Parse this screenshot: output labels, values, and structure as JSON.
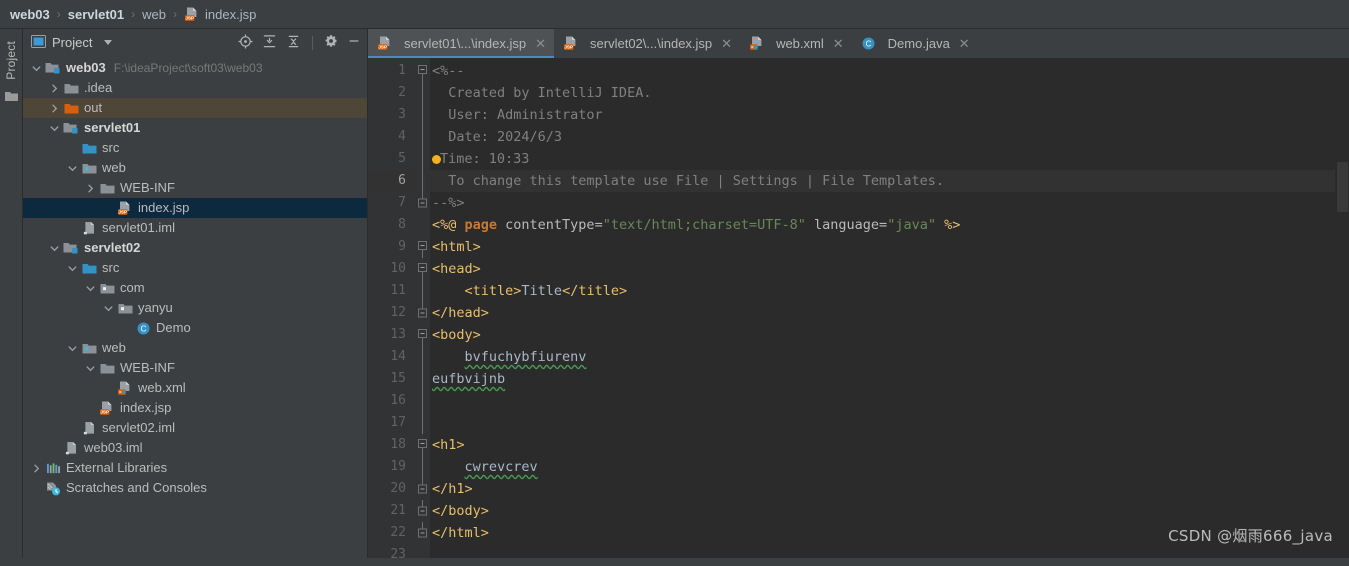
{
  "breadcrumb": {
    "items": [
      {
        "label": "web03",
        "bold": true,
        "icon": null
      },
      {
        "label": "servlet01",
        "bold": true,
        "icon": null
      },
      {
        "label": "web",
        "bold": false,
        "icon": null
      },
      {
        "label": "index.jsp",
        "bold": false,
        "icon": "jsp-file-icon"
      }
    ],
    "separator": "›"
  },
  "toolstrip": {
    "project_label": "Project",
    "folder_icon": "folder-icon"
  },
  "project_panel": {
    "title": "Project",
    "title_icon": "project-view-icon",
    "dropdown_icon": "chevron-down-icon",
    "actions": [
      {
        "name": "select-opened-file-icon",
        "tooltip": "Select Opened File"
      },
      {
        "name": "expand-all-icon",
        "tooltip": "Expand All"
      },
      {
        "name": "collapse-all-icon",
        "tooltip": "Collapse All"
      },
      {
        "name": "gear-icon",
        "tooltip": "Settings"
      },
      {
        "name": "hide-icon",
        "tooltip": "Hide"
      }
    ],
    "tree": [
      {
        "indent": 0,
        "twisty": "down",
        "icon": "module-folder-icon",
        "label": "web03",
        "bold": true,
        "path": "F:\\ideaProject\\soft03\\web03",
        "state": "normal"
      },
      {
        "indent": 1,
        "twisty": "right",
        "icon": "folder-icon",
        "label": ".idea",
        "bold": false,
        "path": "",
        "state": "normal"
      },
      {
        "indent": 1,
        "twisty": "right",
        "icon": "folder-orange-icon",
        "label": "out",
        "bold": false,
        "path": "",
        "state": "highlight"
      },
      {
        "indent": 1,
        "twisty": "down",
        "icon": "module-folder-icon",
        "label": "servlet01",
        "bold": true,
        "path": "",
        "state": "normal"
      },
      {
        "indent": 2,
        "twisty": "none",
        "icon": "source-folder-icon",
        "label": "src",
        "bold": false,
        "path": "",
        "state": "normal"
      },
      {
        "indent": 2,
        "twisty": "down",
        "icon": "web-folder-icon",
        "label": "web",
        "bold": false,
        "path": "",
        "state": "normal"
      },
      {
        "indent": 3,
        "twisty": "right",
        "icon": "folder-icon",
        "label": "WEB-INF",
        "bold": false,
        "path": "",
        "state": "normal"
      },
      {
        "indent": 4,
        "twisty": "none",
        "icon": "jsp-file-icon",
        "label": "index.jsp",
        "bold": false,
        "path": "",
        "state": "selected"
      },
      {
        "indent": 2,
        "twisty": "none",
        "icon": "iml-file-icon",
        "label": "servlet01.iml",
        "bold": false,
        "path": "",
        "state": "normal"
      },
      {
        "indent": 1,
        "twisty": "down",
        "icon": "module-folder-icon",
        "label": "servlet02",
        "bold": true,
        "path": "",
        "state": "normal"
      },
      {
        "indent": 2,
        "twisty": "down",
        "icon": "source-folder-icon",
        "label": "src",
        "bold": false,
        "path": "",
        "state": "normal"
      },
      {
        "indent": 3,
        "twisty": "down",
        "icon": "package-folder-icon",
        "label": "com",
        "bold": false,
        "path": "",
        "state": "normal"
      },
      {
        "indent": 4,
        "twisty": "down",
        "icon": "package-folder-icon",
        "label": "yanyu",
        "bold": false,
        "path": "",
        "state": "normal"
      },
      {
        "indent": 5,
        "twisty": "none",
        "icon": "java-class-icon",
        "label": "Demo",
        "bold": false,
        "path": "",
        "state": "normal"
      },
      {
        "indent": 2,
        "twisty": "down",
        "icon": "web-folder-icon",
        "label": "web",
        "bold": false,
        "path": "",
        "state": "normal"
      },
      {
        "indent": 3,
        "twisty": "down",
        "icon": "folder-icon",
        "label": "WEB-INF",
        "bold": false,
        "path": "",
        "state": "normal"
      },
      {
        "indent": 4,
        "twisty": "none",
        "icon": "xml-file-icon",
        "label": "web.xml",
        "bold": false,
        "path": "",
        "state": "normal"
      },
      {
        "indent": 3,
        "twisty": "none",
        "icon": "jsp-file-icon",
        "label": "index.jsp",
        "bold": false,
        "path": "",
        "state": "normal"
      },
      {
        "indent": 2,
        "twisty": "none",
        "icon": "iml-file-icon",
        "label": "servlet02.iml",
        "bold": false,
        "path": "",
        "state": "normal"
      },
      {
        "indent": 1,
        "twisty": "none",
        "icon": "iml-file-icon",
        "label": "web03.iml",
        "bold": false,
        "path": "",
        "state": "normal"
      },
      {
        "indent": 0,
        "twisty": "right",
        "icon": "external-libraries-icon",
        "label": "External Libraries",
        "bold": false,
        "path": "",
        "state": "normal"
      },
      {
        "indent": 0,
        "twisty": "none",
        "icon": "scratches-icon",
        "label": "Scratches and Consoles",
        "bold": false,
        "path": "",
        "state": "normal"
      }
    ]
  },
  "editor": {
    "tabs": [
      {
        "label": "servlet01\\...\\index.jsp",
        "icon": "jsp-file-icon",
        "active": true,
        "close": "✕"
      },
      {
        "label": "servlet02\\...\\index.jsp",
        "icon": "jsp-file-icon",
        "active": false,
        "close": "✕"
      },
      {
        "label": "web.xml",
        "icon": "xml-file-icon",
        "active": false,
        "close": "✕"
      },
      {
        "label": "Demo.java",
        "icon": "java-class-icon",
        "active": false,
        "close": "✕"
      }
    ],
    "current_line": 6,
    "line_numbers": [
      "1",
      "2",
      "3",
      "4",
      "5",
      "6",
      "7",
      "8",
      "9",
      "10",
      "11",
      "12",
      "13",
      "14",
      "15",
      "16",
      "17",
      "18",
      "19",
      "20",
      "21",
      "22",
      "23"
    ],
    "lines": [
      {
        "n": 1,
        "fold": "start",
        "tokens": [
          {
            "t": "<%--",
            "c": "tok-cmt"
          }
        ]
      },
      {
        "n": 2,
        "fold": "bar",
        "tokens": [
          {
            "t": "  Created by IntelliJ IDEA.",
            "c": "tok-cmt"
          }
        ]
      },
      {
        "n": 3,
        "fold": "bar",
        "tokens": [
          {
            "t": "  User: Administrator",
            "c": "tok-cmt"
          }
        ]
      },
      {
        "n": 4,
        "fold": "bar",
        "tokens": [
          {
            "t": "  Date: 2024/6/3",
            "c": "tok-cmt"
          }
        ]
      },
      {
        "n": 5,
        "fold": "bar",
        "bulb": true,
        "tokens": [
          {
            "t": "Time: 10:33",
            "c": "tok-cmt"
          }
        ]
      },
      {
        "n": 6,
        "fold": "bar",
        "tokens": [
          {
            "t": "  To change this template use File | Settings | File Templates.",
            "c": "tok-cmt"
          }
        ]
      },
      {
        "n": 7,
        "fold": "end",
        "tokens": [
          {
            "t": "--%>",
            "c": "tok-cmt"
          }
        ]
      },
      {
        "n": 8,
        "fold": "none",
        "tokens": [
          {
            "t": "<%@ ",
            "c": "tok-dir"
          },
          {
            "t": "page",
            "c": "tok-kw"
          },
          {
            "t": " contentType=",
            "c": "tok-attr"
          },
          {
            "t": "\"text/html;charset=UTF-8\"",
            "c": "tok-str"
          },
          {
            "t": " language=",
            "c": "tok-attr"
          },
          {
            "t": "\"java\"",
            "c": "tok-str"
          },
          {
            "t": " %>",
            "c": "tok-dir"
          }
        ]
      },
      {
        "n": 9,
        "fold": "start",
        "tokens": [
          {
            "t": "<html>",
            "c": "tok-tag"
          }
        ]
      },
      {
        "n": 10,
        "fold": "start",
        "tokens": [
          {
            "t": "<head>",
            "c": "tok-tag"
          }
        ]
      },
      {
        "n": 11,
        "fold": "bar",
        "tokens": [
          {
            "t": "    ",
            "c": "tok-plain"
          },
          {
            "t": "<title>",
            "c": "tok-tag"
          },
          {
            "t": "Title",
            "c": "tok-txt"
          },
          {
            "t": "</title>",
            "c": "tok-tag"
          }
        ]
      },
      {
        "n": 12,
        "fold": "end",
        "tokens": [
          {
            "t": "</head>",
            "c": "tok-tag"
          }
        ]
      },
      {
        "n": 13,
        "fold": "start",
        "tokens": [
          {
            "t": "<body>",
            "c": "tok-tag"
          }
        ]
      },
      {
        "n": 14,
        "fold": "bar",
        "tokens": [
          {
            "t": "    ",
            "c": "tok-plain"
          },
          {
            "t": "bvfuchybfiurenv",
            "c": "tok-txt spell"
          }
        ]
      },
      {
        "n": 15,
        "fold": "bar",
        "tokens": [
          {
            "t": "eufbvijnb",
            "c": "tok-txt spell"
          }
        ]
      },
      {
        "n": 16,
        "fold": "bar",
        "tokens": [
          {
            "t": "",
            "c": "tok-plain"
          }
        ]
      },
      {
        "n": 17,
        "fold": "bar",
        "tokens": [
          {
            "t": "",
            "c": "tok-plain"
          }
        ]
      },
      {
        "n": 18,
        "fold": "start",
        "tokens": [
          {
            "t": "<h1>",
            "c": "tok-tag"
          }
        ]
      },
      {
        "n": 19,
        "fold": "bar",
        "tokens": [
          {
            "t": "    ",
            "c": "tok-plain"
          },
          {
            "t": "cwrevcrev",
            "c": "tok-txt spell"
          }
        ]
      },
      {
        "n": 20,
        "fold": "end",
        "tokens": [
          {
            "t": "</h1>",
            "c": "tok-tag"
          }
        ]
      },
      {
        "n": 21,
        "fold": "end",
        "tokens": [
          {
            "t": "</body>",
            "c": "tok-tag"
          }
        ]
      },
      {
        "n": 22,
        "fold": "end",
        "tokens": [
          {
            "t": "</html>",
            "c": "tok-tag"
          }
        ]
      },
      {
        "n": 23,
        "fold": "none",
        "tokens": [
          {
            "t": "",
            "c": "tok-plain"
          }
        ]
      }
    ]
  },
  "watermark": {
    "text": "CSDN @烟雨666_java"
  },
  "colors": {
    "panel_bg": "#3c3f41",
    "editor_bg": "#2b2b2b",
    "gutter_bg": "#313335",
    "selection": "#0d293e",
    "highlight_row": "#4e4636",
    "tab_active": "#4e5254",
    "tab_underline": "#4a88c7",
    "accent_orange": "#cc7832",
    "string_green": "#6a8759",
    "tag_yellow": "#e8bf6a",
    "comment_grey": "#808080",
    "spell_green": "#499c54"
  }
}
